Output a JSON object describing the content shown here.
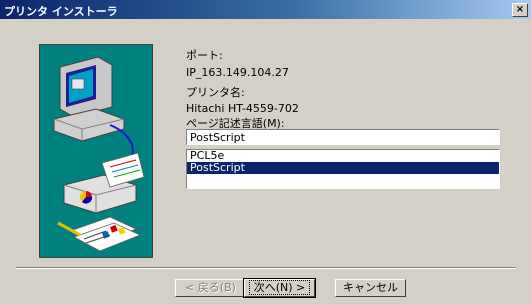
{
  "window": {
    "title": "プリンタ インストーラ",
    "close_glyph": "×"
  },
  "info": {
    "port_label": "ポート:",
    "port_value": "IP_163.149.104.27",
    "printer_name_label": "プリンタ名:",
    "printer_name_value": "Hitachi HT-4559-702",
    "pdl_label": "ページ記述言語(M):"
  },
  "pdl_input": {
    "value": "PostScript"
  },
  "pdl_options": [
    {
      "label": "PCL5e",
      "selected": false
    },
    {
      "label": "PostScript",
      "selected": true
    }
  ],
  "buttons": {
    "back": "< 戻る(B)",
    "next": "次へ(N) >",
    "cancel": "キャンセル"
  },
  "colors": {
    "title_active": "#0a246a",
    "selection": "#0a246a",
    "illustration_bg": "#00807f",
    "dialog_bg": "#d4d0c8"
  }
}
